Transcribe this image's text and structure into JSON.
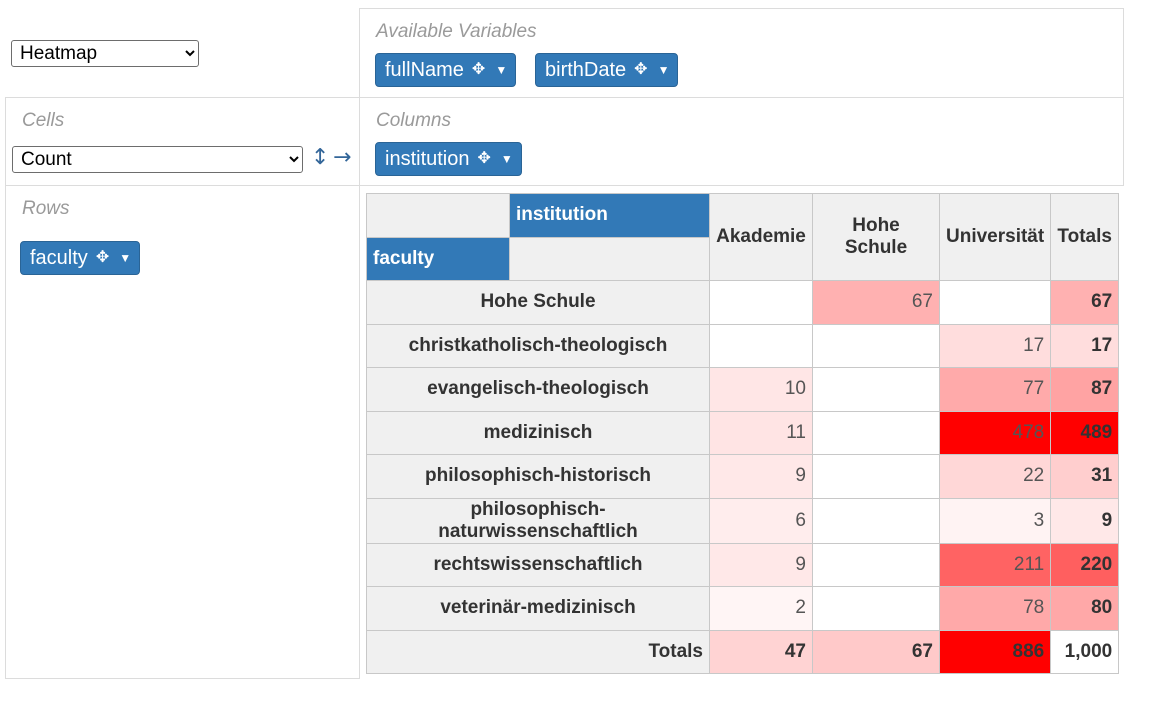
{
  "renderer": {
    "selected": "Heatmap",
    "options": [
      "Heatmap"
    ]
  },
  "aggregator": {
    "selected": "Count",
    "options": [
      "Count"
    ],
    "sort_icon": "↕",
    "order_icon": "→"
  },
  "available": {
    "label": "Available Variables",
    "fields": [
      "fullName",
      "birthDate"
    ]
  },
  "cells_label": "Cells",
  "columns": {
    "label": "Columns",
    "fields": [
      "institution"
    ]
  },
  "rows": {
    "label": "Rows",
    "fields": [
      "faculty"
    ]
  },
  "icons": {
    "move": "✥",
    "caret": "▼"
  },
  "table": {
    "col_axis": "institution",
    "row_axis": "faculty",
    "columns": [
      "Akademie",
      "Hohe Schule",
      "Universität"
    ],
    "totals_label": "Totals",
    "rows": [
      {
        "label": "Hohe Schule",
        "values": [
          "",
          "67",
          ""
        ],
        "total": "67"
      },
      {
        "label": "christkatholisch-theologisch",
        "values": [
          "",
          "",
          "17"
        ],
        "total": "17"
      },
      {
        "label": "evangelisch-theologisch",
        "values": [
          "10",
          "",
          "77"
        ],
        "total": "87"
      },
      {
        "label": "medizinisch",
        "values": [
          "11",
          "",
          "478"
        ],
        "total": "489"
      },
      {
        "label": "philosophisch-historisch",
        "values": [
          "9",
          "",
          "22"
        ],
        "total": "31"
      },
      {
        "label": "philosophisch-naturwissenschaftlich",
        "values": [
          "6",
          "",
          "3"
        ],
        "total": "9"
      },
      {
        "label": "rechtswissenschaftlich",
        "values": [
          "9",
          "",
          "211"
        ],
        "total": "220"
      },
      {
        "label": "veterinär-medizinisch",
        "values": [
          "2",
          "",
          "78"
        ],
        "total": "80"
      }
    ],
    "col_totals": [
      "47",
      "67",
      "886"
    ],
    "grand_total": "1,000"
  },
  "colors": {
    "accent": "#3279b7",
    "heat_max": "#ff0000",
    "heat_min": "#ffffff"
  }
}
